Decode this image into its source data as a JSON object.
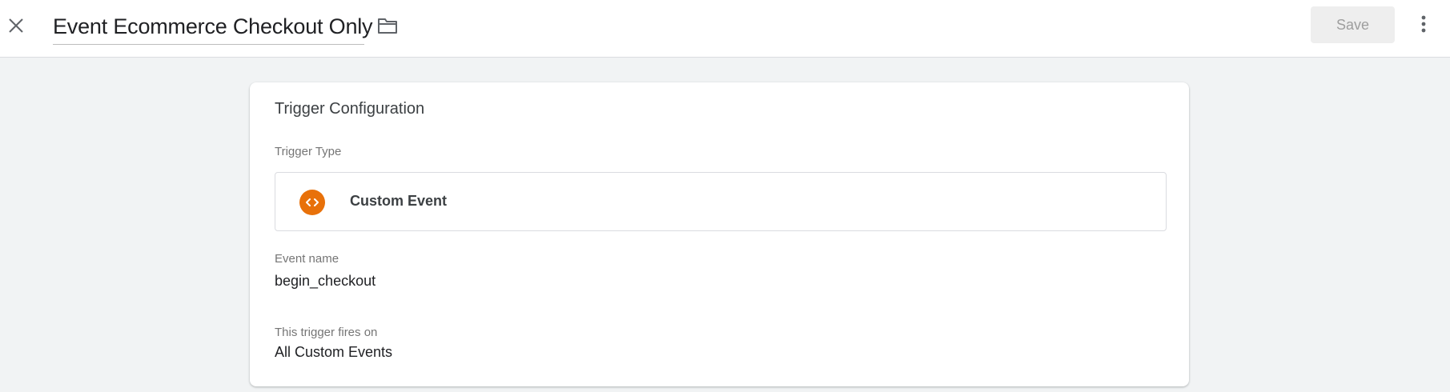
{
  "header": {
    "title": "Event Ecommerce Checkout Only",
    "save_label": "Save",
    "icons": {
      "close": "close-icon",
      "folder": "folder-icon",
      "more": "more-vert-icon"
    }
  },
  "card": {
    "title": "Trigger Configuration",
    "trigger_type": {
      "label": "Trigger Type",
      "value": "Custom Event",
      "icon": "custom-event-icon",
      "icon_color": "#e8710a"
    },
    "event_name": {
      "label": "Event name",
      "value": "begin_checkout"
    },
    "fires_on": {
      "label": "This trigger fires on",
      "value": "All Custom Events"
    }
  }
}
